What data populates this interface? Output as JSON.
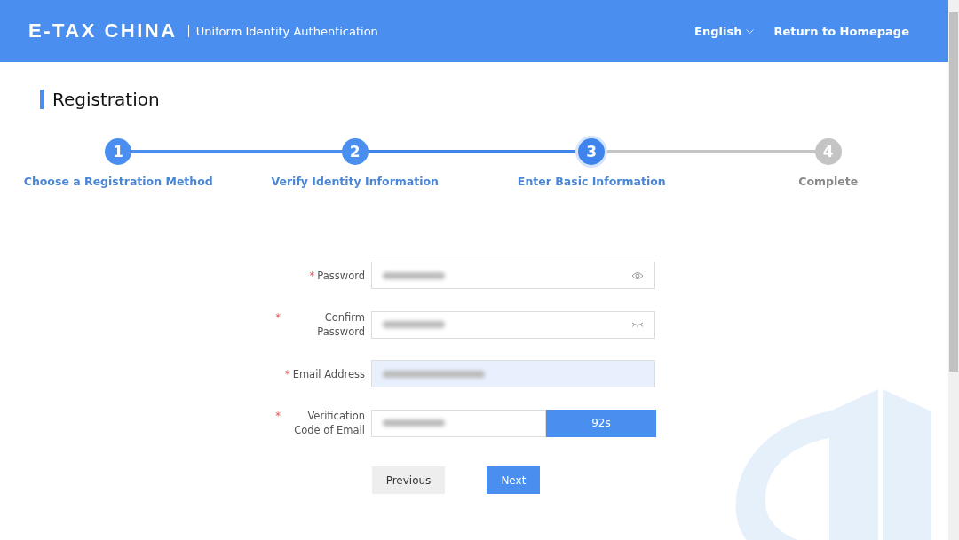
{
  "header": {
    "brand": "E-TAX CHINA",
    "subtitle": "Uniform Identity Authentication",
    "language": "English",
    "home_link": "Return to Homepage"
  },
  "page_title": "Registration",
  "steps": [
    {
      "number": "1",
      "label": "Choose a Registration Method",
      "selected": false
    },
    {
      "number": "2",
      "label": "Verify Identity Information",
      "selected": false
    },
    {
      "number": "3",
      "label": "Enter Basic Information",
      "selected": true
    },
    {
      "number": "4",
      "label": "Complete",
      "selected": false
    }
  ],
  "fields": [
    {
      "kind": "password",
      "required_mark": "*",
      "label": "Password",
      "revealed": true,
      "highlighted": false
    },
    {
      "kind": "password",
      "required_mark": "*",
      "label": "Confirm Password",
      "revealed": false,
      "highlighted": false
    },
    {
      "kind": "text",
      "required_mark": "*",
      "label": "Email Address",
      "highlighted": true
    },
    {
      "kind": "code",
      "required_mark": "*",
      "label": "Verification Code of Email",
      "highlighted": false,
      "button": "92s"
    }
  ],
  "buttons": [
    {
      "kind": "secondary",
      "label": "Previous"
    },
    {
      "kind": "primary",
      "label": "Next"
    }
  ]
}
